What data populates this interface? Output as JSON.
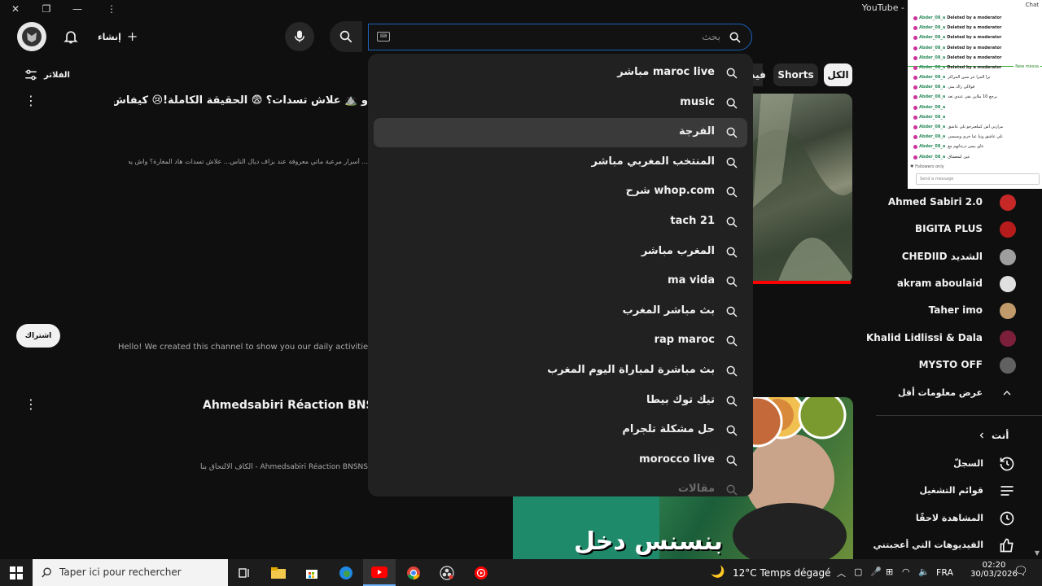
{
  "window": {
    "title": "YouTube - ",
    "chat_label": "Chat"
  },
  "header": {
    "create_label": "إنشاء",
    "search_placeholder": "بحث"
  },
  "suggestions": [
    "maroc live مباشر",
    "music",
    "الفرجة",
    "المنتخب المغربي مباشر",
    "whop.com شرح",
    "tach 21",
    "المغرب مباشر",
    "ma vida",
    "بث مباشر المغرب",
    "rap maroc",
    "بث مباشرة لمباراة اليوم المغرب",
    "تيك توك بيطا",
    "حل مشكلة تلجرام",
    "morocco live",
    "مقالات"
  ],
  "chips": {
    "all": "الكل",
    "shorts": "Shorts",
    "videos": "فيد"
  },
  "filters_label": "الفلاتر",
  "video1": {
    "title": "و ⛰️ علاش تسدات؟ 😨 الحقيقة الكاملة!😢 كيفاش ماتت استادة 🤫",
    "desc": "... أسرار مرعبة ماتي معروفة عند بزاف ديال الناس... علاش تسدات هاد المغارة؟ واش يصح"
  },
  "subscribe_label": "اشتراك",
  "about_text": "Hello! We created this channel to show you our daily activities in the ju",
  "channel": {
    "name": "Ahmedsabiri Réaction BNSNS",
    "desc": "Ahmedsabiri Réaction BNSNS - الكاف الالتحاق بنا على"
  },
  "thumb2_text": "بنسنس دخل",
  "chat": {
    "user": "Abder_08_a",
    "deleted": "Deleted by a moderator",
    "new_messages": "New messa",
    "followers_only": "Followers only",
    "send_placeholder": "Send a message",
    "lines": [
      "برا المرا عز سين المراكز",
      "قولالي راك متى",
      "يرجع 10 ملاين بقى عندي تعد",
      "",
      "",
      "مرارتي أش كملعبرجو تلي عاشق",
      "تلي عاشق ونبا عيا خرى وسيسي",
      "عاي بيمن درجاتهم مع",
      "عين كمعشاق"
    ]
  },
  "subscriptions": [
    {
      "name": "Ahmed Sabiri 2.0",
      "avatar_color": "#c62828"
    },
    {
      "name": "BIGITA PLUS",
      "avatar_color": "#b71c1c"
    },
    {
      "name": "الشديد CHEDIID",
      "avatar_color": "#9e9e9e"
    },
    {
      "name": "akram aboulaid",
      "avatar_color": "#e0e0e0"
    },
    {
      "name": "Taher imo",
      "avatar_color": "#c19a6b"
    },
    {
      "name": "Khalid Lidlissi & Dala",
      "avatar_color": "#7b1f3a"
    },
    {
      "name": "MYSTO OFF",
      "avatar_color": "#616161"
    }
  ],
  "show_more_label": "عرض معلومات أقل",
  "you_label": "أنت",
  "library": [
    {
      "label": "السجلّ",
      "icon": "history-icon"
    },
    {
      "label": "قوائم التشغيل",
      "icon": "playlist-icon"
    },
    {
      "label": "المشاهدة لاحقًا",
      "icon": "watch-later-icon"
    },
    {
      "label": "الفيديوهات التي أعجبتني",
      "icon": "thumb-up-icon"
    }
  ],
  "taskbar": {
    "search_placeholder": "Taper ici pour rechercher",
    "weather": "12°C  Temps dégagé",
    "lang": "FRA",
    "time": "02:20",
    "date": "30/03/2026"
  },
  "colors": {
    "accent_blue": "#1c62b9",
    "youtube_red": "#ff0000"
  }
}
